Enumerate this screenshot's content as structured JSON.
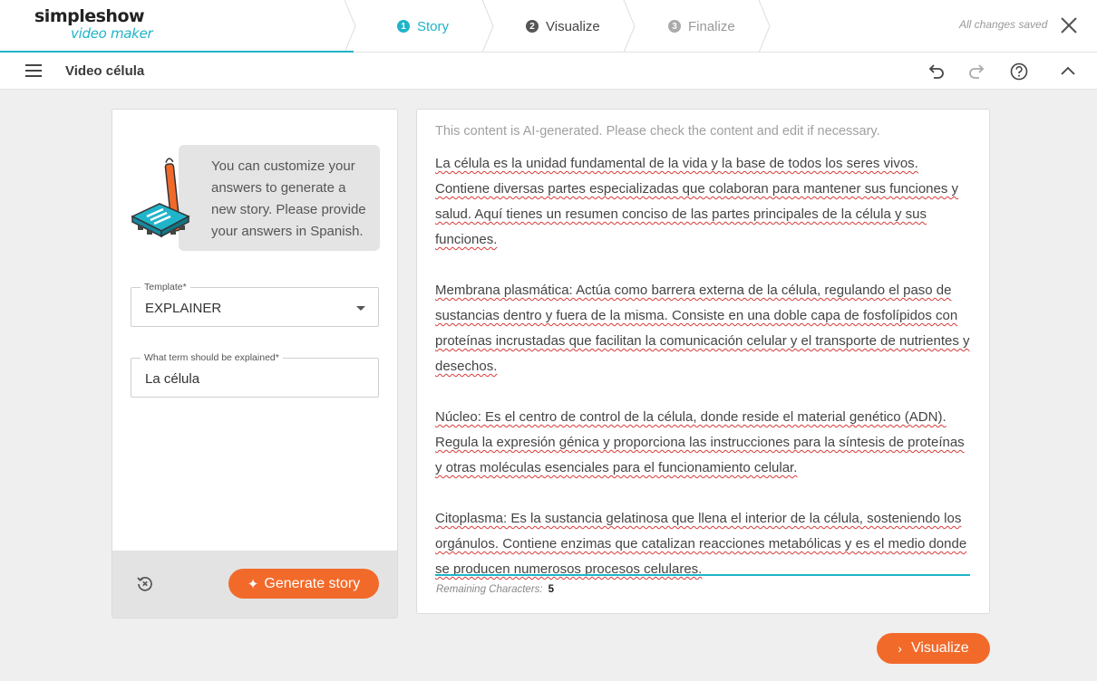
{
  "brand": {
    "name": "simpleshow",
    "sub": "video maker",
    "accent": "#1fb4c9",
    "orange": "#f26a2a"
  },
  "steps": [
    {
      "num": "1",
      "label": "Story",
      "state": "active"
    },
    {
      "num": "2",
      "label": "Visualize",
      "state": "next"
    },
    {
      "num": "3",
      "label": "Finalize",
      "state": "disabled"
    }
  ],
  "header": {
    "save_status": "All changes saved",
    "close_icon": "close-icon"
  },
  "subbar": {
    "menu_icon": "hamburger-menu-icon",
    "title": "Video célula",
    "icons": [
      "undo-icon",
      "redo-icon",
      "help-icon",
      "collapse-chevron-icon"
    ]
  },
  "left": {
    "info": "You can customize your answers to generate a new story. Please provide your answers in Spanish.",
    "template_label": "Template*",
    "template_value": "EXPLAINER",
    "term_label": "What term should be explained*",
    "term_value": "La célula",
    "generate_label": "Generate story",
    "reset_icon": "reset-icon"
  },
  "right": {
    "ai_note": "This content is AI-generated. Please check the content and edit if necessary.",
    "paragraphs": [
      "La célula es la unidad fundamental de la vida y la base de todos los seres vivos. Contiene diversas partes especializadas que colaboran para mantener sus funciones y salud. Aquí tienes un resumen conciso de las partes principales de la célula y sus funciones.",
      "Membrana plasmática: Actúa como barrera externa de la célula, regulando el paso de sustancias dentro y fuera de la misma. Consiste en una doble capa de fosfolípidos con proteínas incrustadas que facilitan la comunicación celular y el transporte de nutrientes y desechos.",
      "Núcleo: Es el centro de control de la célula, donde reside el material genético (ADN). Regula la expresión génica y proporciona las instrucciones para la síntesis de proteínas y otras moléculas esenciales para el funcionamiento celular.",
      "Citoplasma: Es la sustancia gelatinosa que llena el interior de la célula, sosteniendo los orgánulos. Contiene enzimas que catalizan reacciones metabólicas y es el medio donde se producen numerosos procesos celulares."
    ],
    "remaining_label": "Remaining Characters:",
    "remaining_value": "5"
  },
  "visualize_label": "Visualize"
}
